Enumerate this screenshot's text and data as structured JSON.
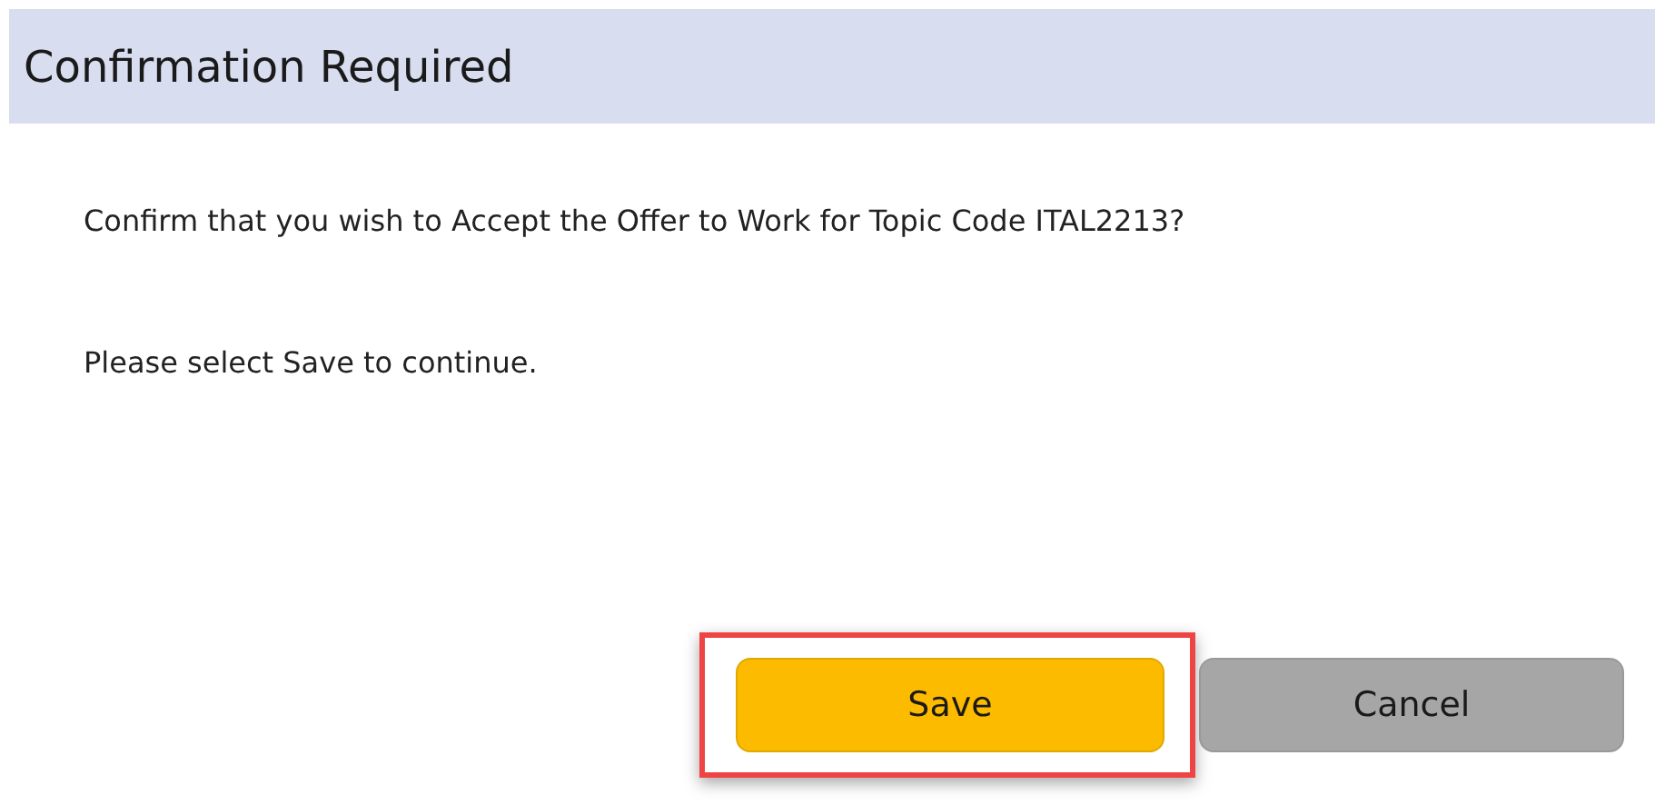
{
  "dialog": {
    "title": "Confirmation Required"
  },
  "messages": [
    "Confirm that you wish to Accept the Offer to Work for Topic Code ITAL2213?",
    "Please select Save to continue."
  ],
  "buttons": [
    {
      "label": "Save",
      "kind": "primary",
      "highlighted": true
    },
    {
      "label": "Cancel",
      "kind": "secondary",
      "highlighted": false
    }
  ]
}
